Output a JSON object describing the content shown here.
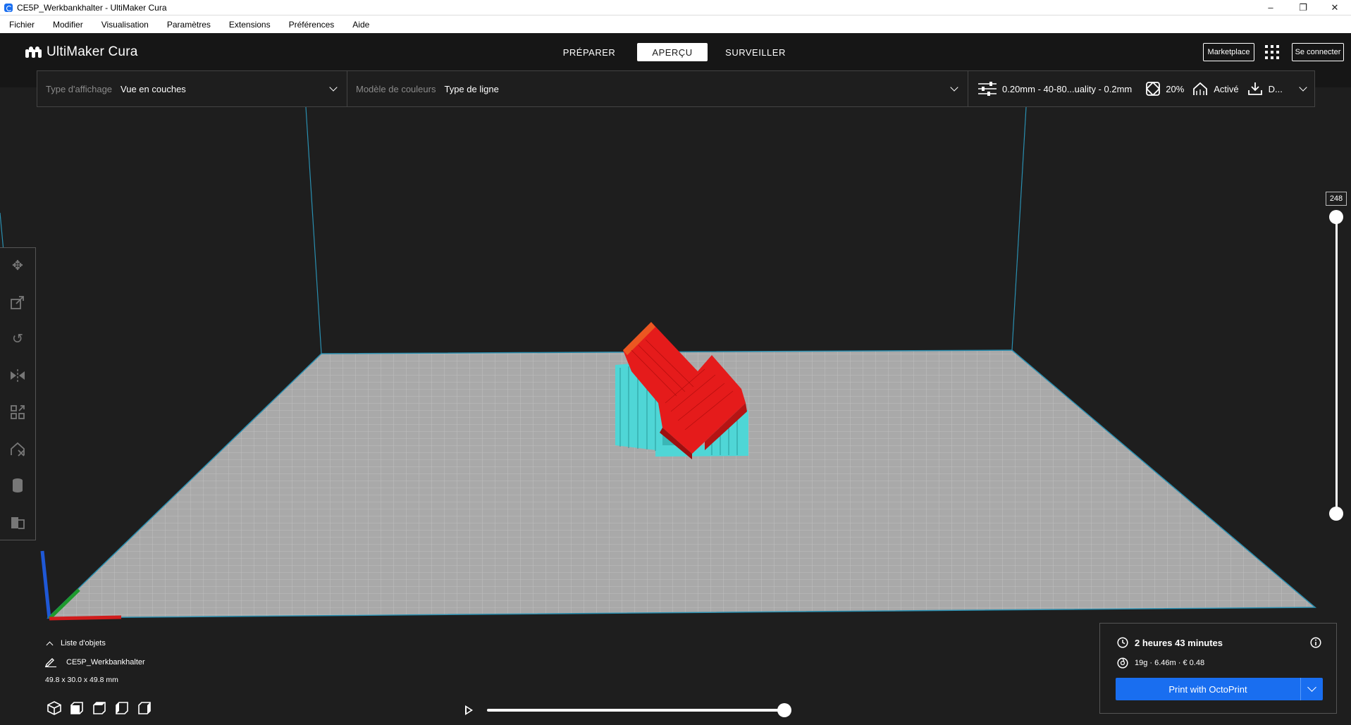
{
  "window": {
    "title": "CE5P_Werkbankhalter - UltiMaker Cura",
    "controls": [
      "minimize-icon",
      "restore-icon",
      "close-icon"
    ]
  },
  "menu": {
    "items": [
      "Fichier",
      "Modifier",
      "Visualisation",
      "Paramètres",
      "Extensions",
      "Préférences",
      "Aide"
    ]
  },
  "header": {
    "logo": "UltiMaker Cura",
    "stages": [
      {
        "label": "PRÉPARER",
        "active": false
      },
      {
        "label": "APERÇU",
        "active": true
      },
      {
        "label": "SURVEILLER",
        "active": false
      }
    ],
    "marketplace_label": "Marketplace",
    "signin_label": "Se connecter"
  },
  "settings_bar": {
    "view_type_label": "Type d'affichage",
    "view_type_value": "Vue en couches",
    "color_scheme_label": "Modèle de couleurs",
    "color_scheme_value": "Type de ligne",
    "profile": "0.20mm - 40-80...uality - 0.2mm",
    "infill": "20%",
    "support": "Activé",
    "adhesion": "D..."
  },
  "layer_slider": {
    "current_layer": "248",
    "level": 1.0
  },
  "object_list": {
    "header": "Liste d'objets",
    "object_name": "CE5P_Werkbankhalter",
    "dimensions": "49.8 x 30.0 x 49.8 mm"
  },
  "playback": {
    "progress": 1.0
  },
  "print_panel": {
    "time": "2 heures 43 minutes",
    "material": "19g · 6.46m · € 0.48",
    "print_button": "Print with OctoPrint"
  },
  "colors": {
    "accent": "#196ef0",
    "model_top": "#e51b1b",
    "model_support": "#4fd6d6",
    "build_plate": "#a9a9a9",
    "background": "#1e1e1e"
  }
}
